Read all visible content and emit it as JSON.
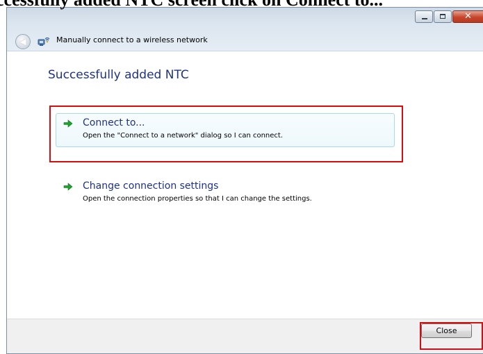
{
  "document": {
    "caption": "ccessfully added NTC screen click on Connect to..."
  },
  "window": {
    "title": "Manually connect to a wireless network",
    "controls": {
      "minimize_icon": "minimize-icon",
      "maximize_icon": "maximize-icon",
      "close_glyph": "✕"
    },
    "back_glyph": "◀"
  },
  "main": {
    "heading": "Successfully added NTC",
    "options": [
      {
        "title": "Connect to...",
        "description": "Open the \"Connect to a network\" dialog so I can connect.",
        "icon": "green-arrow-icon"
      },
      {
        "title": "Change connection settings",
        "description": "Open the connection properties so that I can change the settings.",
        "icon": "green-arrow-icon"
      }
    ]
  },
  "footer": {
    "close_label": "Close"
  },
  "colors": {
    "heading": "#1e3287",
    "callout": "#d40d12",
    "arrow": "#1fa12f"
  }
}
